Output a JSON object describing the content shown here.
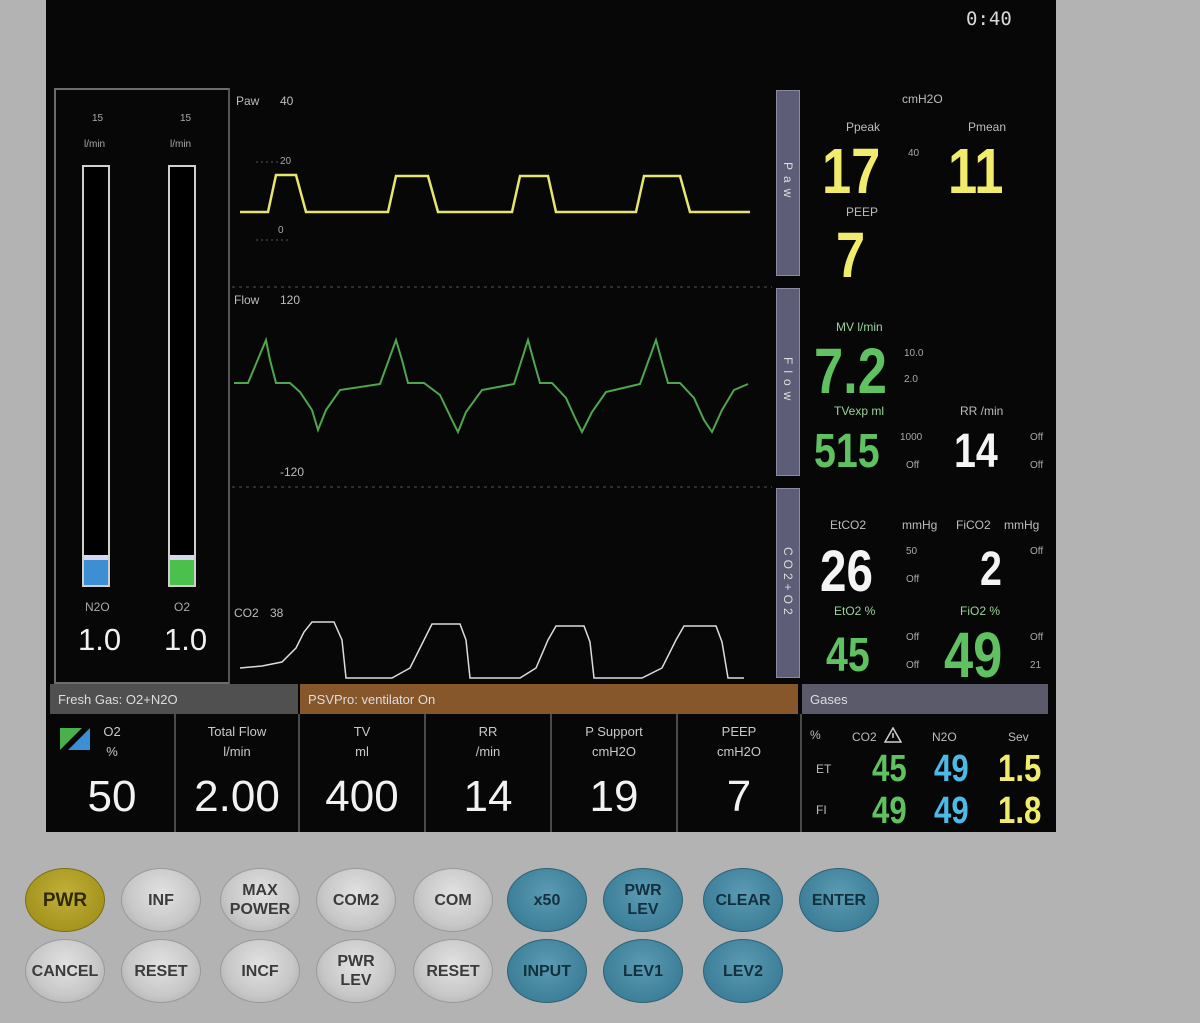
{
  "clock": "0:40",
  "gauges": [
    {
      "top_label": "15",
      "unit": "l/min",
      "name": "N2O",
      "value": "1.0",
      "fraction": 0.06,
      "color": "#3b8fd2"
    },
    {
      "top_label": "15",
      "unit": "l/min",
      "name": "O2",
      "value": "1.0",
      "fraction": 0.06,
      "color": "#4cc04c"
    }
  ],
  "waveforms": {
    "paw": {
      "label": "Paw",
      "max": "40",
      "mid": "20",
      "min": "0",
      "color": "#e6e66e"
    },
    "flow": {
      "label": "Flow",
      "max": "120",
      "min": "-120",
      "color": "#4fa64f"
    },
    "co2": {
      "label": "CO2",
      "max": "38",
      "color": "#dcdcdc"
    }
  },
  "side_tabs": [
    {
      "text": "Paw"
    },
    {
      "text": "Flow"
    },
    {
      "text": "CO2+O2"
    }
  ],
  "pressure": {
    "unit": "cmH2O",
    "ppeak_label": "Ppeak",
    "ppeak": "17",
    "limit": "40",
    "pmean_label": "Pmean",
    "pmean": "11",
    "peep_label": "PEEP",
    "peep": "7"
  },
  "volume": {
    "mv_label": "MV l/min",
    "mv": "7.2",
    "mv_hi": "10.0",
    "mv_lo": "2.0",
    "tv_label": "TVexp ml",
    "tv": "515",
    "tv_hi": "1000",
    "tv_lo": "Off",
    "rr_label": "RR /min",
    "rr": "14",
    "rr_hi": "Off",
    "rr_lo": "Off"
  },
  "gases_panel": {
    "etco2_label": "EtCO2",
    "etco2_unit": "mmHg",
    "etco2": "26",
    "etco2_hi": "50",
    "etco2_lo": "Off",
    "fico2_label": "FiCO2",
    "fico2_unit": "mmHg",
    "fico2": "2",
    "fico2_hi": "Off",
    "eto2_label": "EtO2 %",
    "eto2": "45",
    "eto2_hi": "Off",
    "eto2_lo": "Off",
    "fio2_label": "FiO2 %",
    "fio2": "49",
    "fio2_hi": "Off",
    "fio2_lo": "21"
  },
  "bottom": {
    "fresh_gas_header": "Fresh Gas: O2+N2O",
    "vent_header": "PSVPro: ventilator On",
    "gases_header": "Gases",
    "settings": [
      {
        "label1": "O2",
        "label2": "%",
        "value": "50"
      },
      {
        "label1": "Total Flow",
        "label2": "l/min",
        "value": "2.00"
      },
      {
        "label1": "TV",
        "label2": "ml",
        "value": "400"
      },
      {
        "label1": "RR",
        "label2": "/min",
        "value": "14"
      },
      {
        "label1": "P Support",
        "label2": "cmH2O",
        "value": "19"
      },
      {
        "label1": "PEEP",
        "label2": "cmH2O",
        "value": "7"
      }
    ],
    "gas_table": {
      "col_sym": "%",
      "cols": [
        "CO2",
        "N2O",
        "Sev"
      ],
      "rows": [
        {
          "name": "ET",
          "values": [
            "45",
            "49",
            "1.5"
          ]
        },
        {
          "name": "FI",
          "values": [
            "49",
            "49",
            "1.8"
          ]
        }
      ]
    }
  },
  "buttons": {
    "row1": [
      "PWR",
      "INF",
      "MAX POWER",
      "COM2",
      "COM",
      "x50",
      "PWR LEV",
      "CLEAR",
      "ENTER"
    ],
    "row2": [
      "CANCEL",
      "RESET",
      "INCF",
      "PWR LEV",
      "RESET",
      "INPUT",
      "LEV1",
      "LEV2"
    ]
  },
  "colors": {
    "yellow": "#f2ec6c",
    "green": "#5fc15f",
    "cyan": "#4db9e6",
    "white": "#f4f4f4",
    "vent_header": "#8a5a2b",
    "gray_header": "#555555"
  }
}
